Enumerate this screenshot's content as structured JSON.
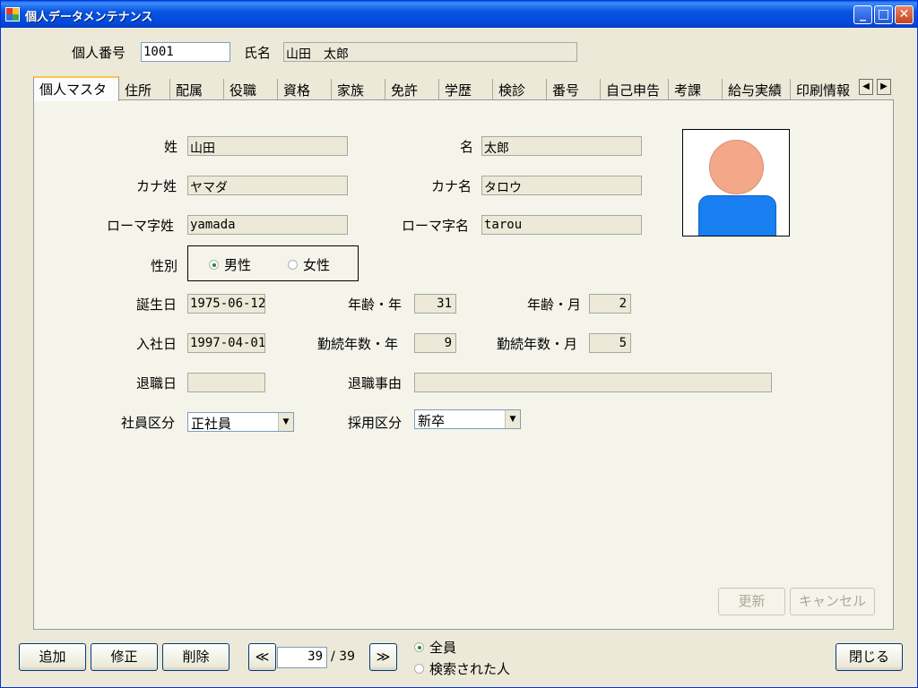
{
  "window": {
    "title": "個人データメンテナンス",
    "minimize": "_",
    "maximize": "□",
    "close": "✕"
  },
  "header": {
    "id_label": "個人番号",
    "id_value": "1001",
    "name_label": "氏名",
    "name_value": "山田　太郎"
  },
  "tabs": [
    {
      "label": "個人マスタ",
      "active": true
    },
    {
      "label": "住所"
    },
    {
      "label": "配属"
    },
    {
      "label": "役職"
    },
    {
      "label": "資格"
    },
    {
      "label": "家族"
    },
    {
      "label": "免許"
    },
    {
      "label": "学歴"
    },
    {
      "label": "検診"
    },
    {
      "label": "番号"
    },
    {
      "label": "自己申告"
    },
    {
      "label": "考課"
    },
    {
      "label": "給与実績"
    },
    {
      "label": "印刷情報"
    }
  ],
  "tab_scroll": {
    "left": "◀",
    "right": "▶"
  },
  "form": {
    "sei_label": "姓",
    "sei_value": "山田",
    "mei_label": "名",
    "mei_value": "太郎",
    "kana_sei_label": "カナ姓",
    "kana_sei_value": "ヤマダ",
    "kana_mei_label": "カナ名",
    "kana_mei_value": "タロウ",
    "roma_sei_label": "ローマ字姓",
    "roma_sei_value": "yamada",
    "roma_mei_label": "ローマ字名",
    "roma_mei_value": "tarou",
    "gender_label": "性別",
    "gender_male": "男性",
    "gender_female": "女性",
    "gender_selected": "男性",
    "birth_label": "誕生日",
    "birth_value": "1975-06-12",
    "age_year_label": "年齢・年",
    "age_year_value": "31",
    "age_month_label": "年齢・月",
    "age_month_value": "2",
    "join_label": "入社日",
    "join_value": "1997-04-01",
    "tenure_year_label": "勤続年数・年",
    "tenure_year_value": "9",
    "tenure_month_label": "勤続年数・月",
    "tenure_month_value": "5",
    "retire_label": "退職日",
    "retire_value": "",
    "retire_reason_label": "退職事由",
    "retire_reason_value": "",
    "emp_type_label": "社員区分",
    "emp_type_value": "正社員",
    "hire_type_label": "採用区分",
    "hire_type_value": "新卒",
    "update_button": "更新",
    "cancel_button": "キャンセル"
  },
  "footer": {
    "add_button": "追加",
    "edit_button": "修正",
    "delete_button": "削除",
    "prev_button": "≪",
    "next_button": "≫",
    "record_current": "39",
    "record_total": "/ 39",
    "filter_all": "全員",
    "filter_searched": "検索された人",
    "filter_selected": "全員",
    "close_button": "閉じる"
  },
  "colors": {
    "titlebar": "#0854e3",
    "window_bg": "#ece9d8",
    "photo_head": "#f4a88a",
    "photo_body": "#1a7ff0"
  }
}
